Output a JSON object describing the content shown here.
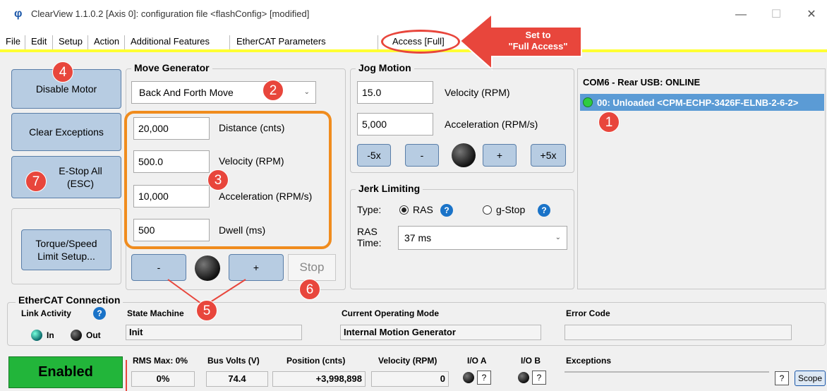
{
  "window": {
    "title": "ClearView 1.1.0.2 [Axis 0]: configuration file <flashConfig> [modified]",
    "minimize": "—",
    "maximize": "☐",
    "close": "✕"
  },
  "menu": [
    "File",
    "Edit",
    "Setup",
    "Action",
    "Additional Features",
    "EtherCAT Parameters",
    "Access [Full]"
  ],
  "callout": {
    "line1": "Set to",
    "line2": "\"Full Access\""
  },
  "buttons": {
    "disable_motor": "Disable Motor",
    "clear_exceptions": "Clear Exceptions",
    "estop_line1": "E-Stop All",
    "estop_line2": "(ESC)",
    "torque_line1": "Torque/Speed",
    "torque_line2": "Limit Setup..."
  },
  "move_generator": {
    "title": "Move Generator",
    "mode": "Back And Forth Move",
    "fields": [
      {
        "value": "20,000",
        "label": "Distance (cnts)"
      },
      {
        "value": "500.0",
        "label": "Velocity (RPM)"
      },
      {
        "value": "10,000",
        "label": "Acceleration (RPM/s)"
      },
      {
        "value": "500",
        "label": "Dwell (ms)"
      }
    ],
    "minus": "-",
    "plus": "+",
    "stop": "Stop"
  },
  "jog": {
    "title": "Jog Motion",
    "velocity_value": "15.0",
    "velocity_label": "Velocity (RPM)",
    "accel_value": "5,000",
    "accel_label": "Acceleration (RPM/s)",
    "b_m5": "-5x",
    "b_m": "-",
    "b_p": "+",
    "b_p5": "+5x"
  },
  "jerk": {
    "title": "Jerk Limiting",
    "type_label": "Type:",
    "opt1": "RAS",
    "opt2": "g-Stop",
    "ras_time_label1": "RAS",
    "ras_time_label2": "Time:",
    "ras_time_value": "37 ms"
  },
  "tree": {
    "header": "COM6 - Rear USB: ONLINE",
    "node": "00: Unloaded <CPM-ECHP-3426F-ELNB-2-6-2>"
  },
  "ethercat": {
    "title": "EtherCAT Connection",
    "link_activity": "Link Activity",
    "in": "In",
    "out": "Out",
    "state_machine_label": "State Machine",
    "state_machine_value": "Init",
    "mode_label": "Current Operating Mode",
    "mode_value": "Internal Motion Generator",
    "error_label": "Error Code",
    "error_value": ""
  },
  "status": {
    "enabled": "Enabled",
    "rms_label": "RMS Max: 0%",
    "rms_value": "0%",
    "bus_label": "Bus Volts (V)",
    "bus_value": "74.4",
    "pos_label": "Position (cnts)",
    "pos_value": "+3,998,898",
    "vel_label": "Velocity (RPM)",
    "vel_value": "0",
    "ioa_label": "I/O A",
    "iob_label": "I/O B",
    "q": "?",
    "exceptions_label": "Exceptions",
    "exceptions_value": "",
    "scope": "Scope"
  },
  "badges": [
    "1",
    "2",
    "3",
    "4",
    "5",
    "6",
    "7"
  ],
  "colors": {
    "button_blue": "#b7cce2",
    "enabled_green": "#22b53a",
    "selection_blue": "#5b9bd5",
    "badge_red": "#e8463c",
    "orange_highlight": "#f08c1e",
    "menu_underline_yellow": "#ffff33"
  }
}
